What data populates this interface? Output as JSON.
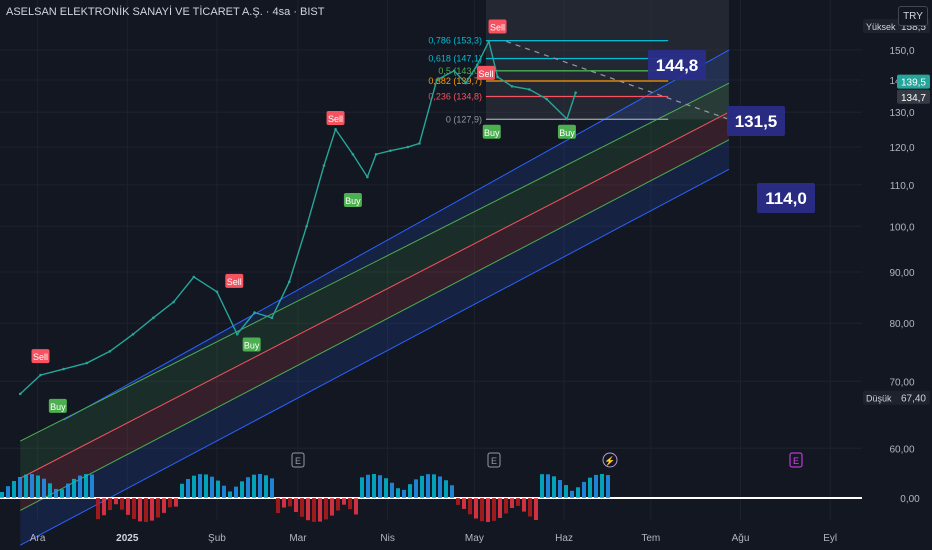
{
  "header": {
    "symbol": "ASELSAN ELEKTRONİK SANAYİ VE TİCARET A.Ş. · 4sa · BIST",
    "currency": "TRY"
  },
  "chart_data": {
    "type": "line",
    "title": "ASELSAN ELEKTRONİK SANAYİ VE TİCARET A.Ş. · 4sa · BIST",
    "y_scale": "log",
    "ylim": [
      58,
      160
    ],
    "y_ticks": [
      "150,0",
      "140,0",
      "130,0",
      "120,0",
      "110,0",
      "100,0",
      "90,00",
      "80,00",
      "70,00",
      "60,00"
    ],
    "x_ticks": [
      "Ara",
      "2025",
      "Şub",
      "Mar",
      "Nis",
      "May",
      "Haz",
      "Tem",
      "Ağu",
      "Eyl"
    ],
    "price_badges": [
      {
        "label": "Yüksek",
        "value": "158,5"
      },
      {
        "label": "",
        "value": "139,5"
      },
      {
        "label": "",
        "value": "134,7"
      },
      {
        "label": "Düşük",
        "value": "67,40"
      }
    ],
    "indicator_zero_label": "0,00",
    "series": [
      {
        "color": "#26a69a",
        "x": [
          "2024-11-25",
          "2024-12-02",
          "2024-12-10",
          "2024-12-18",
          "2024-12-26",
          "2025-01-03",
          "2025-01-10",
          "2025-01-17",
          "2025-01-24",
          "2025-02-01",
          "2025-02-08",
          "2025-02-14",
          "2025-02-20",
          "2025-02-26",
          "2025-03-04",
          "2025-03-10",
          "2025-03-14",
          "2025-03-20",
          "2025-03-25",
          "2025-03-28",
          "2025-04-02",
          "2025-04-08",
          "2025-04-12",
          "2025-04-18",
          "2025-04-24",
          "2025-04-28",
          "2025-05-02",
          "2025-05-06",
          "2025-05-09",
          "2025-05-14",
          "2025-05-20",
          "2025-05-26",
          "2025-06-02",
          "2025-06-05"
        ],
        "values": [
          68,
          71,
          72,
          73,
          75,
          78,
          81,
          84,
          89,
          86,
          78,
          82,
          81,
          88,
          100,
          115,
          125,
          118,
          112,
          118,
          119,
          120,
          121,
          140,
          143,
          139,
          145,
          153,
          141,
          138,
          137,
          134,
          128,
          136
        ]
      }
    ],
    "channel": {
      "lines": [
        {
          "color": "#2962ff",
          "start": "2024-12-10",
          "start_value": 64,
          "end": "2025-07-28",
          "end_value": 150
        },
        {
          "color": "#4caf50",
          "start": "2024-11-25",
          "start_value": 61,
          "end": "2025-07-28",
          "end_value": 139
        },
        {
          "color": "#f7525f",
          "start": "2024-11-25",
          "start_value": 56,
          "end": "2025-07-28",
          "end_value": 130
        },
        {
          "color": "#4caf50",
          "start": "2024-11-25",
          "start_value": 52,
          "end": "2025-07-28",
          "end_value": 122
        },
        {
          "color": "#2962ff",
          "start": "2024-11-25",
          "start_value": 48,
          "end": "2025-07-28",
          "end_value": 114
        }
      ]
    },
    "fibonacci": [
      {
        "label": "0,786 (153,3)",
        "value": 153.3,
        "color": "#00bcd4"
      },
      {
        "label": "0,618 (147,1)",
        "value": 147.1,
        "color": "#00bcd4"
      },
      {
        "label": "0,5 (143,0)",
        "value": 143.0,
        "color": "#4caf50"
      },
      {
        "label": "0,382 (139,7)",
        "value": 139.7,
        "color": "#ff9800"
      },
      {
        "label": "0,236 (134,8)",
        "value": 134.8,
        "color": "#f7525f"
      },
      {
        "label": "0 (127,9)",
        "value": 127.9,
        "color": "#9598a1"
      }
    ],
    "target_labels": [
      "144,8",
      "131,5",
      "114,0"
    ],
    "signals": [
      {
        "type": "Sell",
        "x": "2024-12-02",
        "value": 74
      },
      {
        "type": "Buy",
        "x": "2024-12-08",
        "value": 66
      },
      {
        "type": "Sell",
        "x": "2025-02-07",
        "value": 88
      },
      {
        "type": "Buy",
        "x": "2025-02-13",
        "value": 76
      },
      {
        "type": "Sell",
        "x": "2025-03-14",
        "value": 128
      },
      {
        "type": "Buy",
        "x": "2025-03-20",
        "value": 106
      },
      {
        "type": "Sell",
        "x": "2025-05-05",
        "value": 142
      },
      {
        "type": "Buy",
        "x": "2025-05-07",
        "value": 124
      },
      {
        "type": "Sell",
        "x": "2025-05-09",
        "value": 158
      },
      {
        "type": "Buy",
        "x": "2025-06-02",
        "value": 124
      }
    ],
    "event_markers": [
      "E",
      "E",
      "E"
    ]
  }
}
